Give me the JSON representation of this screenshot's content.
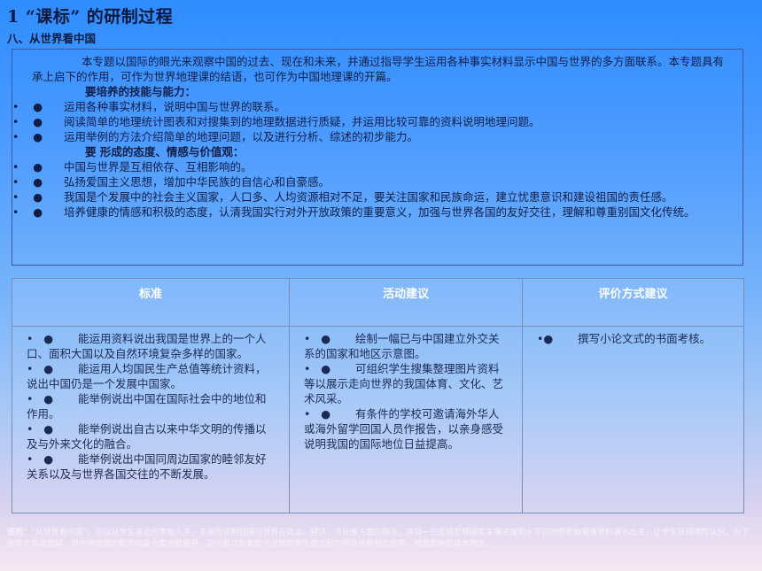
{
  "title": "1 “课标” 的研制过程",
  "subtitle": "八、从世界看中国",
  "intro": {
    "paragraph": "本专题以国际的眼光来观察中国的过去、现在和未来，并通过指导学生运用各种事实材料显示中国与世界的多方面联系。本专题具有承上启下的作用，可作为世界地理课的结语，也可作为中国地理课的开篇。",
    "skills_heading": "要培养的技能与能力：",
    "skills": [
      "运用各种事实材料，说明中国与世界的联系。",
      "阅读简单的地理统计图表和对搜集到的地理数据进行质疑，并运用比较可靠的资料说明地理问题。",
      "运用举例的方法介绍简单的地理问题，以及进行分析、综述的初步能力。"
    ],
    "attitudes_heading": "要 形成的态度、情感与价值观：",
    "attitudes": [
      "中国与世界是互相依存、互相影响的。",
      "弘扬爱国主义思想，增加中华民族的自信心和自豪感。",
      "我国是个发展中的社会主义国家，人口多、人均资源相对不足，要关注国家和民族命运，建立忧患意识和建设祖国的责任感。",
      "培养健康的情感和积极的态度，认清我国实行对外开放政策的重要意义，加强与世界各国的友好交往，理解和尊重别国文化传统。"
    ],
    "bullet_prefix": "•",
    "bullet_dot": "●"
  },
  "table": {
    "headers": [
      "标准",
      "活动建议",
      "评价方式建议"
    ],
    "standards": [
      "能运用资料说出我国是世界上的一个人口、面积大国以及自然环境复杂多样的国家。",
      "能运用人均国民生产总值等统计资料，说出中国仍是一个发展中国家。",
      "能举例说出中国在国际社会中的地位和作用。",
      "能举例说出自古以来中华文明的传播以及与外来文化的融合。",
      "能举例说出中国同周边国家的睦邻友好关系以及与世界各国交往的不断发展。"
    ],
    "activities": [
      "绘制一幅已与中国建立外交关系的国家和地区示意图。",
      "可组织学生搜集整理图片资料等以展示走向世界的我国体育、文化、艺术风采。",
      "有条件的学校可邀请海外华人或海外留学回国人员作报告，以亲身感受说明我国的国际地位日益提高。"
    ],
    "evaluation": [
      "撰写小论文式的书面考核。"
    ]
  },
  "footnote": {
    "label": "说明：",
    "text": "“从世界看中国”，可以从学生身边的事物入手，关举例说明我国与世界在政治、经济、文化等方面的联系，再将一些能够反映国家发展进度和水平的地图和数据等资料展示出来，让学生获得感性认识，为了使学生容易理解，对中国地理的教学内容无需全面展开。应尽量以形象的方式帮助学生建立起中国与世界相互依存、相互影响的基本概念。"
  }
}
